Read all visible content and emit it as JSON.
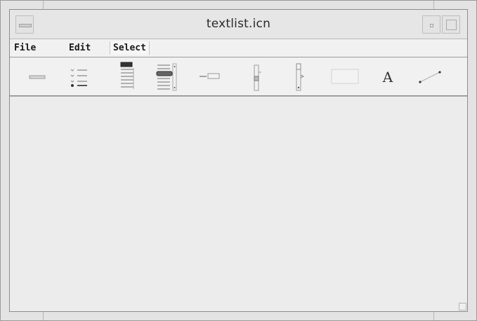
{
  "window": {
    "title": "textlist.icn"
  },
  "menubar": {
    "items": [
      {
        "label": "File"
      },
      {
        "label": "Edit"
      },
      {
        "label": "Select"
      }
    ]
  },
  "toolbar": {
    "tools": [
      {
        "icon": "button-tool-icon"
      },
      {
        "icon": "checkbox-list-tool-icon"
      },
      {
        "icon": "list-tool-icon"
      },
      {
        "icon": "scrolled-list-tool-icon"
      },
      {
        "icon": "text-field-tool-icon"
      },
      {
        "icon": "vertical-slider-tool-icon"
      },
      {
        "icon": "vertical-scrollbar-tool-icon"
      },
      {
        "icon": "region-tool-icon"
      },
      {
        "icon": "text-label-tool-icon",
        "glyph": "A"
      },
      {
        "icon": "line-tool-icon"
      }
    ]
  },
  "colors": {
    "frame": "#e3e3e3",
    "canvas": "#ececec",
    "menubar": "#f1f1f1",
    "border": "#8e8e8e"
  }
}
